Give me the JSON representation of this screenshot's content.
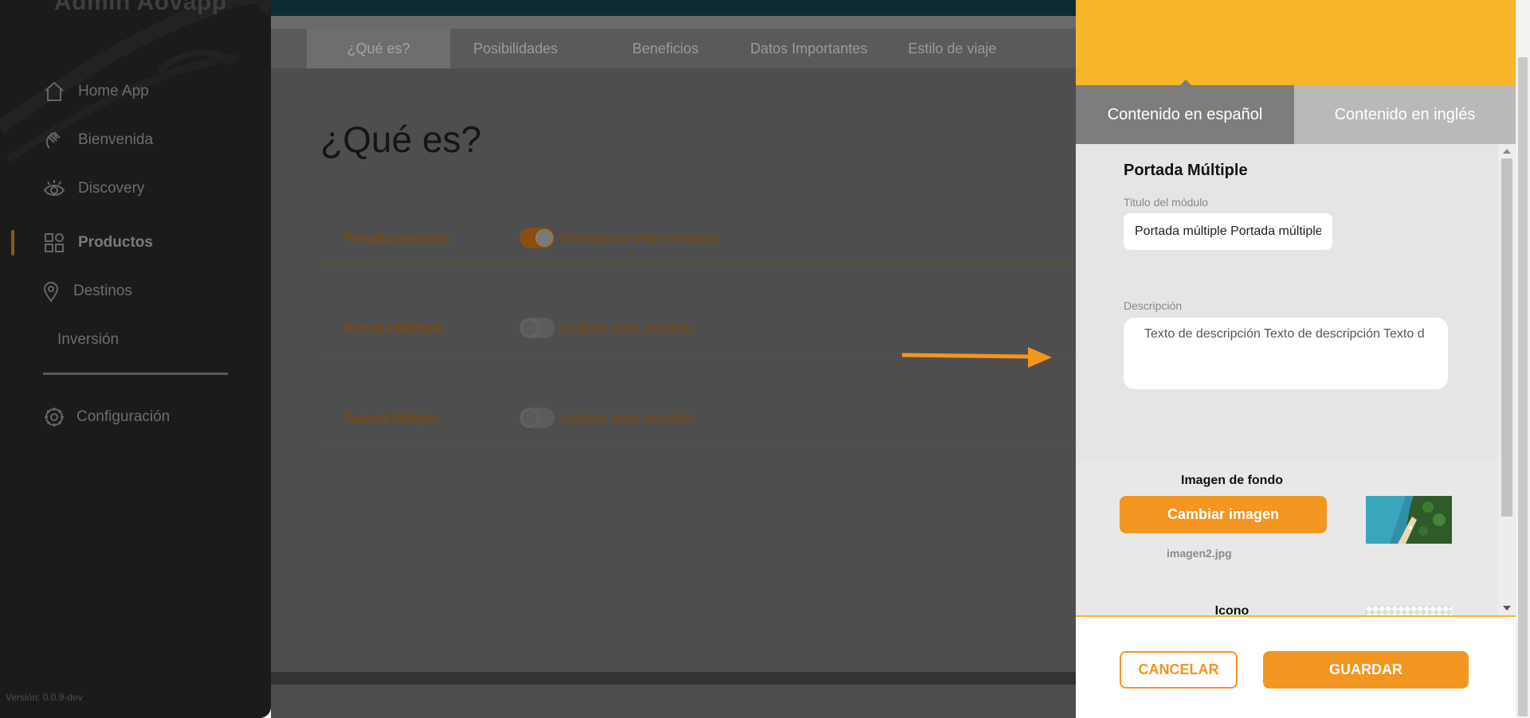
{
  "sidebar": {
    "app_title": "Admin Aovapp",
    "items": [
      {
        "label": "Home App",
        "icon": "home-icon"
      },
      {
        "label": "Bienvenida",
        "icon": "wave-hand-icon"
      },
      {
        "label": "Discovery",
        "icon": "eye-icon"
      },
      {
        "label": "Productos",
        "icon": "grid-icon",
        "active": true
      },
      {
        "label": "Destinos",
        "icon": "location-pin-icon"
      },
      {
        "label": "Inversión",
        "icon": ""
      }
    ],
    "settings": {
      "label": "Configuración",
      "icon": "gear-icon"
    },
    "version": "Versión: 0.0.9-dev"
  },
  "main": {
    "tabs": [
      {
        "label": "¿Qué es?",
        "active": true
      },
      {
        "label": "Posibilidades"
      },
      {
        "label": "Beneficios"
      },
      {
        "label": "Datos Importantes"
      },
      {
        "label": "Estilo de viaje"
      }
    ],
    "page_title": "¿Qué es?",
    "modules": [
      {
        "name": "Portada producto",
        "enabled": true,
        "action": "Desactivar este módulo"
      },
      {
        "name": "Portada Múltiple",
        "enabled": false,
        "action": "Activar este módulo"
      },
      {
        "name": "Galería Múltiple",
        "enabled": false,
        "action": "Activar este módulo"
      }
    ]
  },
  "panel": {
    "lang_tabs": {
      "es": "Contenido en español",
      "en": "Contenido en inglés"
    },
    "section_title": "Portada Múltiple",
    "title_label": "Titulo del módulo",
    "title_value": "Portada múltiple Portada múltiple",
    "description_label": "Descripción",
    "description_value": "Texto de descripción Texto de descripción Texto d",
    "background_label": "Imagen de fondo",
    "change_image_label": "Cambiar imagen",
    "filename": "imagen2.jpg",
    "icon_label": "Icono",
    "cancel_label": "CANCELAR",
    "save_label": "GUARDAR"
  },
  "colors": {
    "accent": "#f39521",
    "header_yellow": "#f7b52a",
    "sidebar_bg": "#1b1b1b",
    "overlay_gray": "#4e4e4e",
    "module_text": "#7a4a12"
  }
}
